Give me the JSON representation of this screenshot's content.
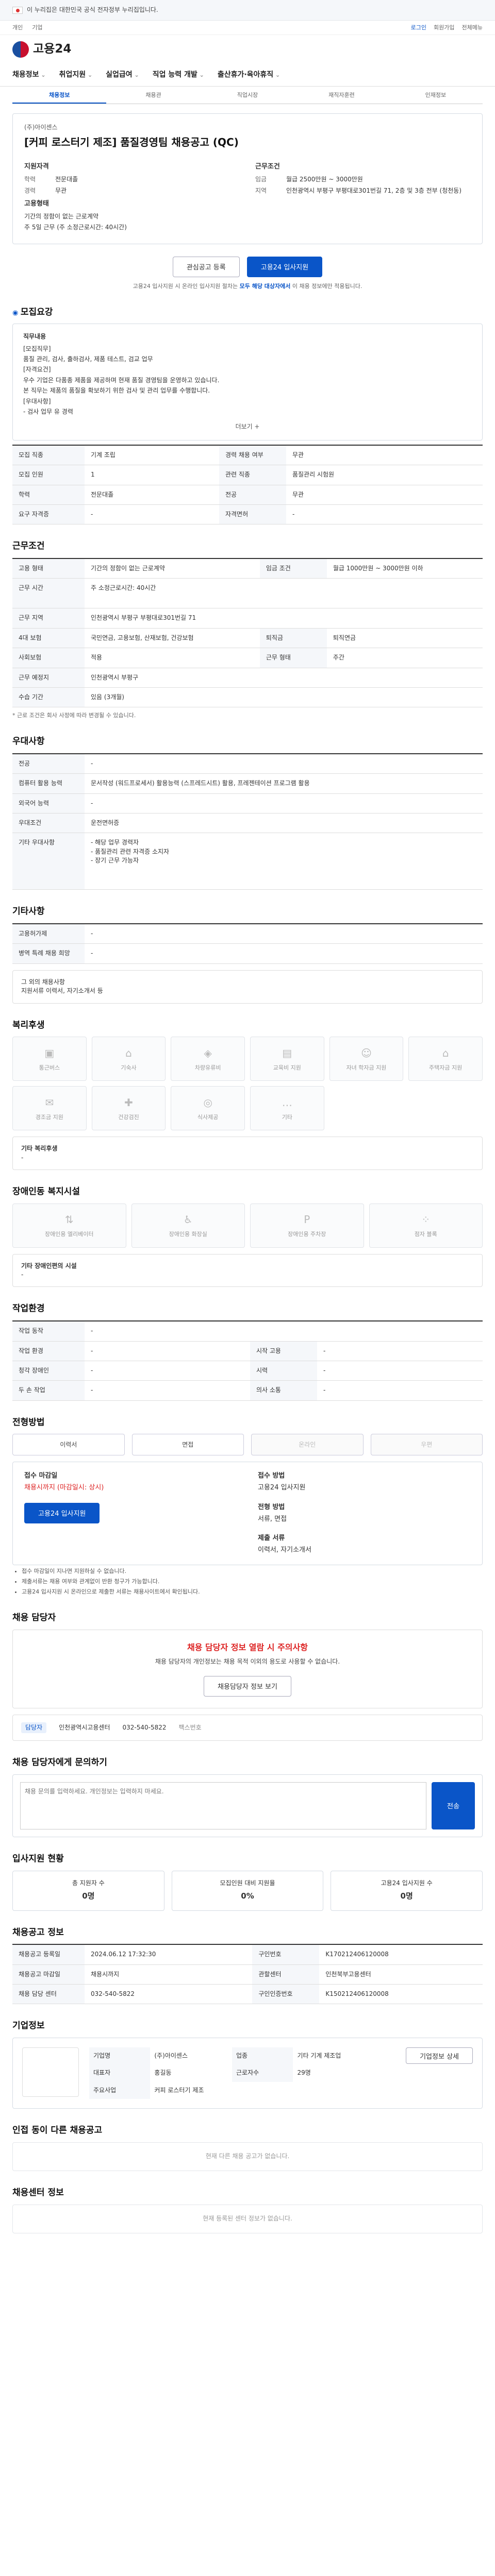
{
  "gov": "이 누리집은 대한민국 공식 전자정부 누리집입니다.",
  "util": {
    "left": [
      "개인",
      "기업"
    ],
    "right": [
      "로그인",
      "회원가입",
      "전체메뉴"
    ]
  },
  "logo": "고용24",
  "gnb": [
    "채용정보",
    "취업지원",
    "실업급여",
    "직업 능력 개발",
    "출산휴가·육아휴직"
  ],
  "subtabs": [
    "채용정보",
    "채용관",
    "직업시장",
    "재직자훈련",
    "인재정보"
  ],
  "job": {
    "company": "(주)아이센스",
    "title": "[커피 로스터기 제조] 품질경영팀 채용공고 (QC)",
    "work_h": "지원자격",
    "edu": "학력",
    "edu_v": "전문대졸",
    "career": "경력",
    "career_v": "무관",
    "cond_h": "근무조건",
    "pay": "임금",
    "pay_v": "월급 2500만원 ~ 3000만원",
    "loc": "지역",
    "loc_v": "인천광역시 부평구 부평대로301번길 71, 2층 및 3층 전부 (청천동)",
    "form_h": "고용형태",
    "form_v": "기간의 정함이 없는 근로계약",
    "time_v": "주 5일 근무 (주 소정근로시간: 40시간)"
  },
  "btn": {
    "interest": "관심공고 등록",
    "apply": "고용24 입사지원"
  },
  "apply_note_a": "고용24 입사지원 시 온라인 입사지원 절차는",
  "apply_note_b": "모두 해당 대상자에서",
  "apply_note_c": "이 채용 정보에만 적용됩니다.",
  "s1": {
    "title": "모집요강",
    "h": "직무내용",
    "lines": [
      "[모집직무]",
      "품질 관리, 검사, 출하검사, 제품 테스트, 검교 업무",
      "[자격요건]",
      "우수 기업은 다품종 제품을 제공하며 현재 품질 경영팀을 운영하고 있습니다.",
      "본 직무는 제품의 품질을 확보하기 위한 검사 및 관리 업무를 수행합니다.",
      "[우대사항]",
      "- 검사 업무 유 경력"
    ],
    "more": "더보기 +"
  },
  "t1": [
    [
      "모집 직종",
      "기계 조립",
      "경력 채용 여부",
      "무관"
    ],
    [
      "모집 인원",
      "1",
      "관련 직종",
      "품질관리 시험원"
    ],
    [
      "학력",
      "전문대졸",
      "전공",
      "무관"
    ],
    [
      "요구 자격증",
      "-",
      "자격면허",
      "-"
    ]
  ],
  "s2": {
    "title": "근무조건"
  },
  "t2": [
    [
      "고용 형태",
      "기간의 정함이 없는 근로계약",
      "임금 조건",
      "월급 1000만원 ~ 3000만원 이하"
    ],
    [
      "근무 시간",
      "주 소정근로시간: 40시간",
      "",
      ""
    ],
    [
      "근무 지역",
      "인천광역시 부평구 부평대로301번길 71",
      "",
      ""
    ],
    [
      "4대 보험",
      "국민연금, 고용보험, 산재보험, 건강보험",
      "퇴직금",
      "퇴직연금"
    ],
    [
      "사회보험",
      "적용",
      "근무 형태",
      "주간"
    ],
    [
      "근무 예정지",
      "인천광역시 부평구",
      "",
      ""
    ],
    [
      "수습 기간",
      "있음 (3개월)",
      "",
      ""
    ]
  ],
  "t2_note": "* 근로 조건은 회사 사정에 따라 변경될 수 있습니다.",
  "s3": {
    "title": "우대사항"
  },
  "t3": [
    [
      "전공",
      "-"
    ],
    [
      "컴퓨터 활용 능력",
      "문서작성 (워드프로세서) 활용능력 (스프레드시트) 활용, 프레젠테이션 프로그램 활용"
    ],
    [
      "외국어 능력",
      "-"
    ],
    [
      "우대조건",
      "운전면허증"
    ],
    [
      "기타 우대사항",
      "- 해당 업무 경력자\n- 품질관리 관련 자격증 소지자\n- 장기 근무 가능자"
    ]
  ],
  "s4": {
    "title": "기타사항"
  },
  "t4": [
    [
      "고용허가제",
      "-"
    ],
    [
      "병역 특례 채용 희망",
      "-"
    ]
  ],
  "s4b": {
    "text1": "그 외의 채용사항",
    "text2": "지원서류 이력서, 자기소개서 등"
  },
  "s5": {
    "title": "복리후생",
    "items": [
      "통근버스",
      "기숙사",
      "차량유류비",
      "교육비 지원",
      "자녀 학자금 지원",
      "주택자금 지원",
      "경조금 지원",
      "건강검진",
      "식사제공",
      "기타"
    ],
    "note_h": "기타 복리후생",
    "note": "-"
  },
  "s6": {
    "title": "장애인동 복지시설",
    "items": [
      "장애인용 엘리베이터",
      "장애인용 화장실",
      "장애인용 주차장",
      "점자 블록"
    ],
    "note_h": "기타 장애인편의 시설",
    "note": "-"
  },
  "s7": {
    "title": "작업환경"
  },
  "t7": [
    [
      "작업 동작",
      "-",
      "",
      ""
    ],
    [
      "작업 환경",
      "-",
      "시작 고용",
      "-"
    ],
    [
      "청각 장애인",
      "-",
      "시력",
      "-"
    ],
    [
      "두 손 작업",
      "-",
      "의사 소통",
      "-"
    ]
  ],
  "s8": {
    "title": "전형방법",
    "ways": [
      "이력서",
      "면접",
      "온라인",
      "우편"
    ],
    "c1": "접수 마감일",
    "c1v": "채용시까지 (마감일시: 상시)",
    "c2": "접수 방법",
    "c2v": "고용24 입사지원",
    "c3": "전형 방법",
    "c3v": "서류, 면접",
    "c4": "제출 서류",
    "c4v": "이력서, 자기소개서",
    "apply": "고용24 입사지원"
  },
  "notes": [
    "접수 마감일이 지나면 지원하실 수 없습니다.",
    "제출서류는 채용 여부와 관계없이 반환 청구가 가능합니다.",
    "고용24 입사지원 시 온라인으로 제출한 서류는 채용사이트에서 확인됩니다."
  ],
  "s9": {
    "title": "채용 담당자",
    "warn": "채용 담당자 정보 열람 시 주의사항",
    "wtext": "채용 담당자의 개인정보는 채용 목적 이외의 용도로 사용할 수 없습니다.",
    "wlink": "채용담당자 정보 보기",
    "ctag": "담당자",
    "co": "인천광역시고용센터",
    "tel": "032-540-5822",
    "fax": "팩스번호"
  },
  "s10": {
    "title": "채용 담당자에게 문의하기",
    "ph": "채용 문의를 입력하세요. 개인정보는 입력하지 마세요.",
    "send": "전송"
  },
  "s11": {
    "title": "입사지원 현황",
    "a": "총 지원자 수",
    "av": "0명",
    "b": "모집인원 대비 지원율",
    "bv": "0%",
    "c": "고용24 입사지원 수",
    "cv": "0명"
  },
  "s12": {
    "title": "채용공고 정보"
  },
  "t12": [
    [
      "채용공고 등록일",
      "2024.06.12 17:32:30",
      "구인번호",
      "K170212406120008"
    ],
    [
      "채용공고 마감일",
      "채용시까지",
      "관할센터",
      "인천북부고용센터"
    ],
    [
      "채용 담당 센터",
      "032-540-5822",
      "구인인증번호",
      "K150212406120008"
    ]
  ],
  "s13": {
    "title": "기업정보",
    "rows": [
      [
        "기업명",
        "(주)아이센스",
        "업종",
        "기타 기계 제조업"
      ],
      [
        "대표자",
        "홍길동",
        "근로자수",
        "29명"
      ],
      [
        "주요사업",
        "커피 로스터기 제조",
        "",
        ""
      ]
    ],
    "detail": "기업정보 상세"
  },
  "s14": {
    "title": "인접 동이 다른 채용공고",
    "empty": "현재 다른 채용 공고가 없습니다."
  },
  "s15": {
    "title": "채용센터 정보",
    "empty": "현재 등록된 센터 정보가 없습니다."
  }
}
